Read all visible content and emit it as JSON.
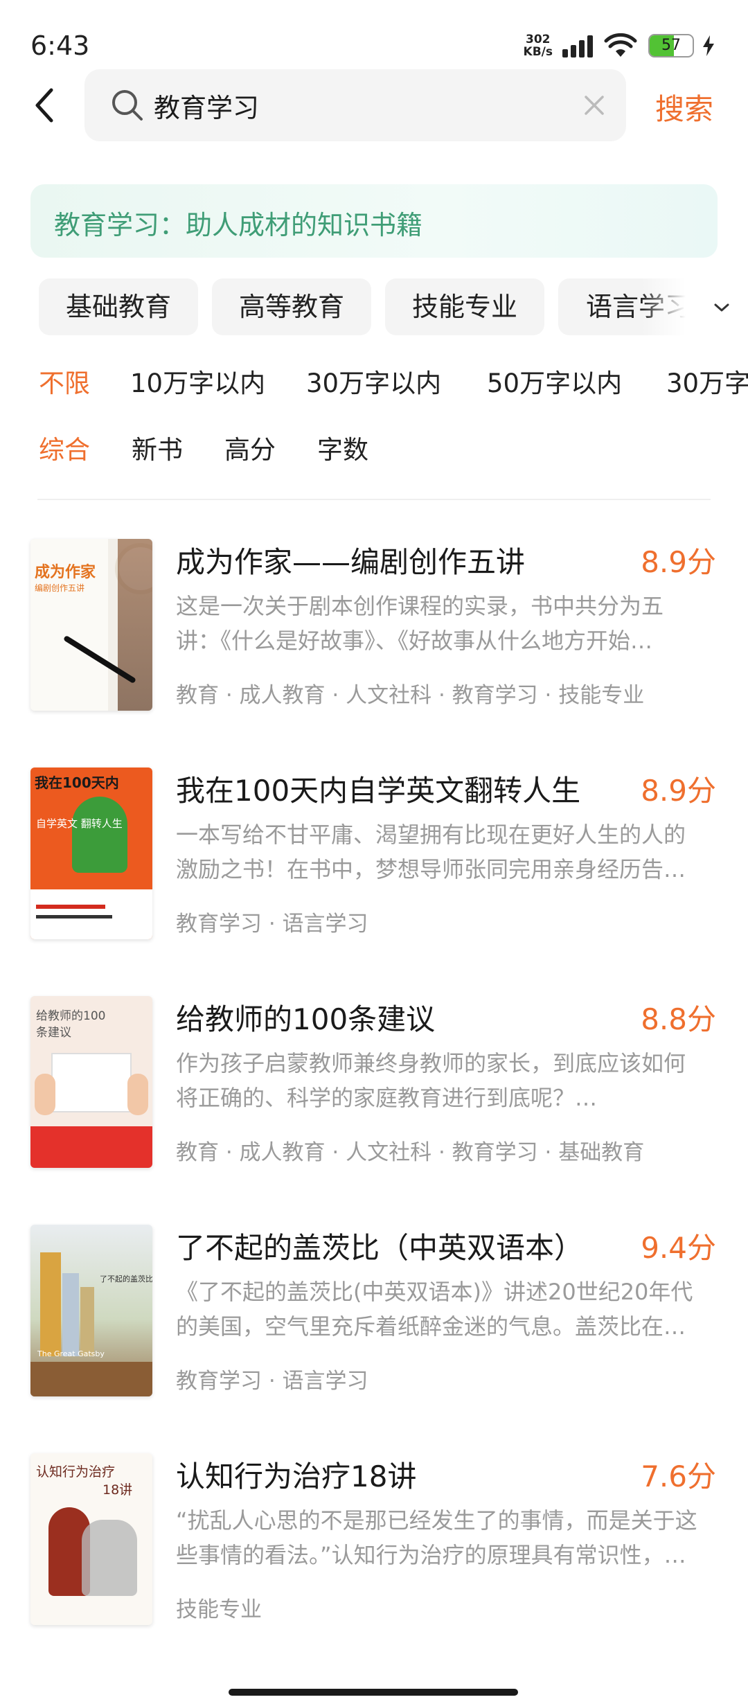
{
  "status_bar": {
    "time": "6:43",
    "net_speed_value": "302",
    "net_speed_unit": "KB/s",
    "battery_level": "57",
    "battery_fraction": 0.57,
    "accent": "#52c234"
  },
  "search": {
    "query": "教育学习",
    "placeholder": "",
    "button_label": "搜索"
  },
  "topic_banner": {
    "text": "教育学习：助人成材的知识书籍"
  },
  "categories": [
    "基础教育",
    "高等教育",
    "技能专业",
    "语言学习"
  ],
  "word_count_filters": {
    "selected": "不限",
    "options": [
      "不限",
      "10万字以内",
      "30万字以内",
      "50万字以内",
      "30万字"
    ]
  },
  "sort_filters": {
    "selected": "综合",
    "options": [
      "综合",
      "新书",
      "高分",
      "字数"
    ]
  },
  "books": [
    {
      "title": "成为作家——编剧创作五讲",
      "score": "8.9分",
      "desc_line1": "这是一次关于剧本创作课程的实录，书中共分为五",
      "desc_line2": "讲：《什么是好故事》、《好故事从什么地方开始…",
      "tags": "教育 · 成人教育 · 人文社科 · 教育学习 · 技能专业",
      "cover_text": "成为作家",
      "cover_sub": "编剧创作五讲"
    },
    {
      "title": "我在100天内自学英文翻转人生",
      "score": "8.9分",
      "desc_line1": "一本写给不甘平庸、渴望拥有比现在更好人生的人的",
      "desc_line2": "激励之书！在书中，梦想导师张同完用亲身经历告…",
      "tags": "教育学习 · 语言学习",
      "cover_text": "我在100天内",
      "cover_sub": "自学英文 翻转人生"
    },
    {
      "title": "给教师的100条建议",
      "score": "8.8分",
      "desc_line1": "作为孩子启蒙教师兼终身教师的家长，到底应该如何",
      "desc_line2": "将正确的、科学的家庭教育进行到底呢？…",
      "tags": "教育 · 成人教育 · 人文社科 · 教育学习 · 基础教育",
      "cover_text": "给教师的100",
      "cover_sub": "条建议"
    },
    {
      "title": "了不起的盖茨比（中英双语本）",
      "score": "9.4分",
      "desc_line1": "《了不起的盖茨比(中英双语本)》讲述20世纪20年代",
      "desc_line2": "的美国，空气里充斥着纸醉金迷的气息。盖茨比在…",
      "tags": "教育学习 · 语言学习",
      "cover_text": "了不起的盖茨比",
      "cover_sub": "The Great Gatsby"
    },
    {
      "title": "认知行为治疗18讲",
      "score": "7.6分",
      "desc_line1": "“扰乱人心思的不是那已经发生了的事情，而是关于这",
      "desc_line2": "些事情的看法。”认知行为治疗的原理具有常识性，…",
      "tags": "技能专业",
      "cover_text": "认知行为治疗",
      "cover_sub": "18讲"
    }
  ],
  "colors": {
    "accent": "#ef6f2e",
    "banner_text": "#3f9d76",
    "chip_bg": "#f4f4f4",
    "muted_text": "#9a9a9a"
  }
}
